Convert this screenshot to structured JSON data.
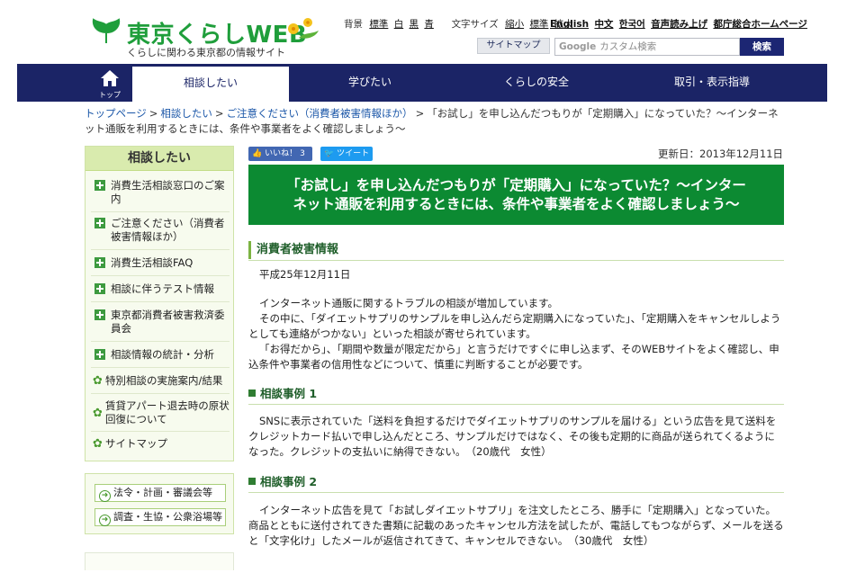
{
  "header": {
    "logo_title": "東京くらしWEB",
    "logo_sub": "くらしに関わる東京都の情報サイト",
    "bg_label": "背景",
    "bg_options": [
      "標準",
      "白",
      "黒",
      "青"
    ],
    "font_label": "文字サイズ",
    "font_options": [
      "縮小",
      "標準",
      "拡大"
    ],
    "lang_links": [
      "English",
      "中文",
      "한국어",
      "音声読み上げ",
      "都庁総合ホームページ"
    ],
    "sitemap_label": "サイトマップ",
    "search_brand": "Google",
    "search_placeholder": "カスタム検索",
    "search_button": "検索"
  },
  "gnav": {
    "home_label": "トップ",
    "items": [
      "相談したい",
      "学びたい",
      "くらしの安全",
      "取引・表示指導"
    ],
    "active_index": 0
  },
  "breadcrumb": {
    "links": [
      "トップページ",
      "相談したい",
      "ご注意ください（消費者被害情報ほか）"
    ],
    "current": "「お試し」を申し込んだつもりが「定期購入」になっていた？〜インターネット通販を利用するときには、条件や事業者をよく確認しましょう〜"
  },
  "sidebar": {
    "heading": "相談したい",
    "items": [
      {
        "label": "消費生活相談窓口のご案内",
        "icon": "plus-icon"
      },
      {
        "label": "ご注意ください（消費者被害情報ほか）",
        "icon": "plus-icon"
      },
      {
        "label": "消費生活相談FAQ",
        "icon": "plus-icon"
      },
      {
        "label": "相談に伴うテスト情報",
        "icon": "plus-icon"
      },
      {
        "label": "東京都消費者被害救済委員会",
        "icon": "plus-icon"
      },
      {
        "label": "相談情報の統計・分析",
        "icon": "plus-icon"
      },
      {
        "label": "特別相談の実施案内/結果",
        "icon": "star-icon"
      },
      {
        "label": "賃貸アパート退去時の原状回復について",
        "icon": "star-icon"
      },
      {
        "label": "サイトマップ",
        "icon": "star-icon"
      }
    ],
    "buttons": [
      "法令・計画・審議会等",
      "調査・生協・公衆浴場等"
    ]
  },
  "social": {
    "like_label": "いいね！",
    "like_count": "3",
    "tweet_label": "ツイート"
  },
  "article": {
    "updated": "更新日：2013年12月11日",
    "title_line1": "「お試し」を申し込んだつもりが「定期購入」になっていた？〜インター",
    "title_line2": "ネット通販を利用するときには、条件や事業者をよく確認しましょう〜",
    "section_heading": "消費者被害情報",
    "date": "平成25年12月11日",
    "intro": [
      "インターネット通販に関するトラブルの相談が増加しています。",
      "その中に、「ダイエットサプリのサンプルを申し込んだら定期購入になっていた」、「定期購入をキャンセルしようとしても連絡がつかない」といった相談が寄せられています。",
      "「お得だから」、「期間や数量が限定だから」と言うだけですぐに申し込まず、そのWEBサイトをよく確認し、申込条件や事業者の信用性などについて、慎重に判断することが必要です。"
    ],
    "case1_heading": "相談事例 1",
    "case1_body": "SNSに表示されていた「送料を負担するだけでダイエットサプリのサンプルを届ける」という広告を見て送料をクレジットカード払いで申し込んだところ、サンプルだけではなく、その後も定期的に商品が送られてくるようになった。クレジットの支払いに納得できない。　（20歳代　女性）",
    "case2_heading": "相談事例 2",
    "case2_body": "インターネット広告を見て「お試しダイエットサプリ」を注文したところ、勝手に「定期購入」となっていた。商品とともに送付されてきた書類に記載のあったキャンセル方法を試したが、電話してもつながらず、メールを送ると「文字化け」したメールが返信されてきて、キャンセルできない。　（30歳代　女性）"
  },
  "colors": {
    "nav_bg": "#1b2466",
    "banner_green": "#0c8a32",
    "logo_green": "#1f9e3b",
    "sidebar_head": "#d9ebae",
    "link_blue": "#1a56a8"
  }
}
